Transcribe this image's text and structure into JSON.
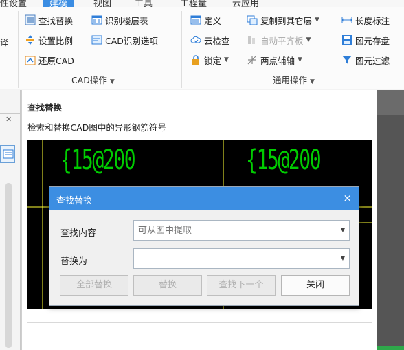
{
  "menubar": {
    "items": [
      "性设置",
      "建模",
      "视图",
      "工具",
      "工程量",
      "云应用"
    ],
    "active_index": 1
  },
  "ribbon": {
    "cad_group": {
      "label": "CAD操作",
      "items": [
        "查找替换",
        "设置比例",
        "还原CAD",
        "识别楼层表",
        "CAD识别选项"
      ]
    },
    "general_group": {
      "label": "通用操作",
      "items": [
        "定义",
        "云检查",
        "锁定",
        "复制到其它层",
        "自动平齐板",
        "两点辅轴",
        "长度标注",
        "图元存盘",
        "图元过滤"
      ]
    },
    "left_cut_char": "译"
  },
  "panel": {
    "title": "查找替换",
    "description": "检索和替换CAD图中的异形钢筋符号",
    "preview_texts": [
      "{15@200",
      "{15@200"
    ]
  },
  "dialog": {
    "title": "查找替换",
    "close": "×",
    "find_label": "查找内容",
    "find_placeholder": "可从图中提取",
    "find_value": "",
    "replace_label": "替换为",
    "replace_value": "",
    "buttons": {
      "replace_all": "全部替换",
      "replace": "替换",
      "find_next": "查找下一个",
      "close": "关闭"
    }
  },
  "colors": {
    "accent": "#3c8ee2",
    "cad_text": "#00cc00",
    "cad_line": "#ffff33"
  }
}
